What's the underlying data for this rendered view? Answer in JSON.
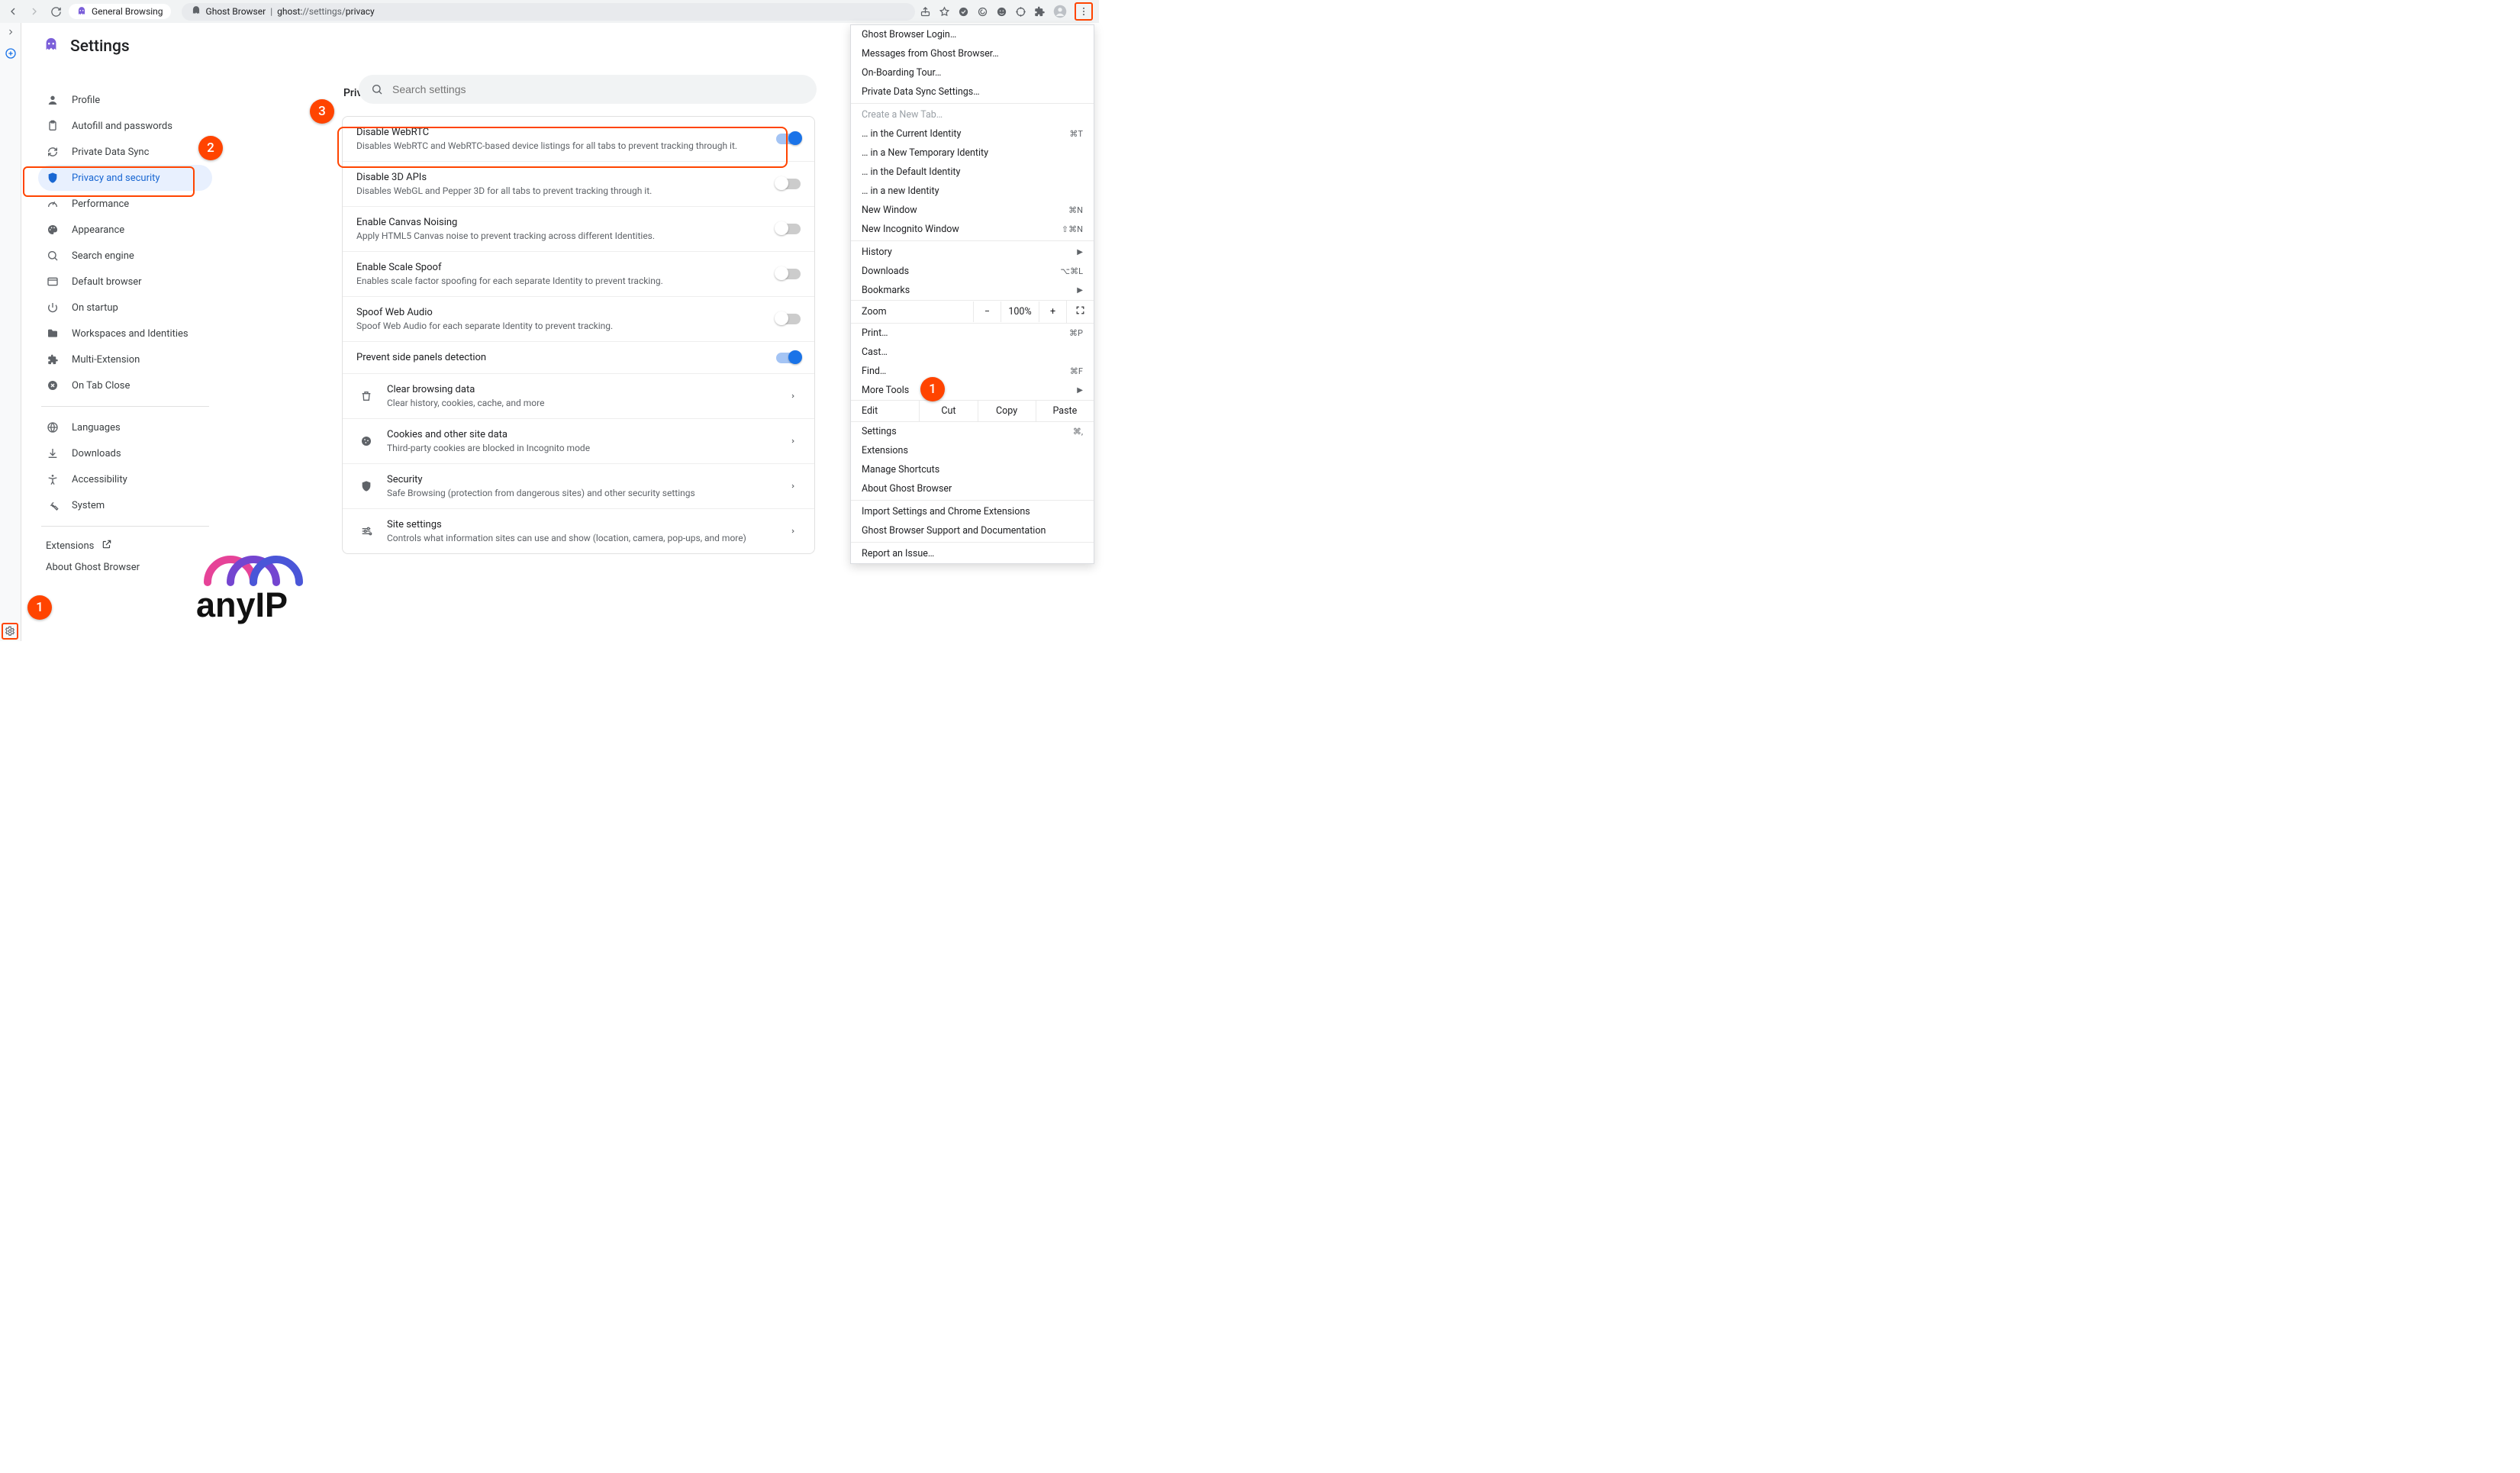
{
  "chrome": {
    "identity_label": "General Browsing",
    "site_label": "Ghost Browser",
    "url_path": "ghost://settings/privacy"
  },
  "settings": {
    "title": "Settings",
    "search_placeholder": "Search settings",
    "sidebar": [
      {
        "icon": "person",
        "label": "Profile"
      },
      {
        "icon": "clipboard",
        "label": "Autofill and passwords"
      },
      {
        "icon": "sync",
        "label": "Private Data Sync"
      },
      {
        "icon": "shield",
        "label": "Privacy and security",
        "active": true
      },
      {
        "icon": "speed",
        "label": "Performance"
      },
      {
        "icon": "palette",
        "label": "Appearance"
      },
      {
        "icon": "search",
        "label": "Search engine"
      },
      {
        "icon": "browser",
        "label": "Default browser"
      },
      {
        "icon": "power",
        "label": "On startup"
      },
      {
        "icon": "folder",
        "label": "Workspaces and Identities"
      },
      {
        "icon": "puzzle",
        "label": "Multi-Extension"
      },
      {
        "icon": "close-circle",
        "label": "On Tab Close"
      }
    ],
    "sidebar2": [
      {
        "icon": "globe",
        "label": "Languages"
      },
      {
        "icon": "download",
        "label": "Downloads"
      },
      {
        "icon": "accessibility",
        "label": "Accessibility"
      },
      {
        "icon": "wrench",
        "label": "System"
      }
    ],
    "links": {
      "extensions": "Extensions",
      "about": "About Ghost Browser"
    },
    "section_title": "Privacy and security",
    "rows": [
      {
        "title": "Disable WebRTC",
        "sub": "Disables WebRTC and WebRTC-based device listings for all tabs to prevent tracking through it.",
        "toggle": true,
        "on": true
      },
      {
        "title": "Disable 3D APIs",
        "sub": "Disables WebGL and Pepper 3D for all tabs to prevent tracking through it.",
        "toggle": true,
        "on": false
      },
      {
        "title": "Enable Canvas Noising",
        "sub": "Apply HTML5 Canvas noise to prevent tracking across different Identities.",
        "toggle": true,
        "on": false
      },
      {
        "title": "Enable Scale Spoof",
        "sub": "Enables scale factor spoofing for each separate Identity to prevent tracking.",
        "toggle": true,
        "on": false
      },
      {
        "title": "Spoof Web Audio",
        "sub": "Spoof Web Audio for each separate Identity to prevent tracking.",
        "toggle": true,
        "on": false
      },
      {
        "title": "Prevent side panels detection",
        "toggle": true,
        "on": true
      },
      {
        "icon": "trash",
        "title": "Clear browsing data",
        "sub": "Clear history, cookies, cache, and more",
        "link": true
      },
      {
        "icon": "cookie",
        "title": "Cookies and other site data",
        "sub": "Third-party cookies are blocked in Incognito mode",
        "link": true
      },
      {
        "icon": "shield",
        "title": "Security",
        "sub": "Safe Browsing (protection from dangerous sites) and other security settings",
        "link": true
      },
      {
        "icon": "tune",
        "title": "Site settings",
        "sub": "Controls what information sites can use and show (location, camera, pop-ups, and more)",
        "link": true
      }
    ]
  },
  "menu": {
    "g1": [
      "Ghost Browser Login…",
      "Messages from Ghost Browser…",
      "On-Boarding Tour…",
      "Private Data Sync Settings…"
    ],
    "disabled": "Create a New Tab…",
    "g2": [
      {
        "label": "… in the Current Identity",
        "sc": "⌘T"
      },
      {
        "label": "… in a New Temporary Identity"
      },
      {
        "label": "… in the Default Identity"
      },
      {
        "label": "… in a new Identity"
      },
      {
        "label": "New Window",
        "sc": "⌘N"
      },
      {
        "label": "New Incognito Window",
        "sc": "⇧⌘N"
      }
    ],
    "g3": [
      {
        "label": "History",
        "arr": true
      },
      {
        "label": "Downloads",
        "sc": "⌥⌘L"
      },
      {
        "label": "Bookmarks",
        "arr": true
      }
    ],
    "zoom": {
      "label": "Zoom",
      "value": "100%",
      "minus": "−",
      "plus": "+"
    },
    "g4": [
      {
        "label": "Print…",
        "sc": "⌘P"
      },
      {
        "label": "Cast…"
      },
      {
        "label": "Find…",
        "sc": "⌘F"
      },
      {
        "label": "More Tools",
        "arr": true
      }
    ],
    "edit": {
      "label": "Edit",
      "cut": "Cut",
      "copy": "Copy",
      "paste": "Paste"
    },
    "g5": [
      {
        "label": "Settings",
        "sc": "⌘,"
      },
      {
        "label": "Extensions"
      },
      {
        "label": "Manage Shortcuts"
      },
      {
        "label": "About Ghost Browser"
      }
    ],
    "g6": [
      "Import Settings and Chrome Extensions",
      "Ghost Browser Support and Documentation"
    ],
    "g7": [
      "Report an Issue…"
    ]
  },
  "callouts": {
    "1": "1",
    "1b": "1",
    "2": "2",
    "3": "3"
  }
}
